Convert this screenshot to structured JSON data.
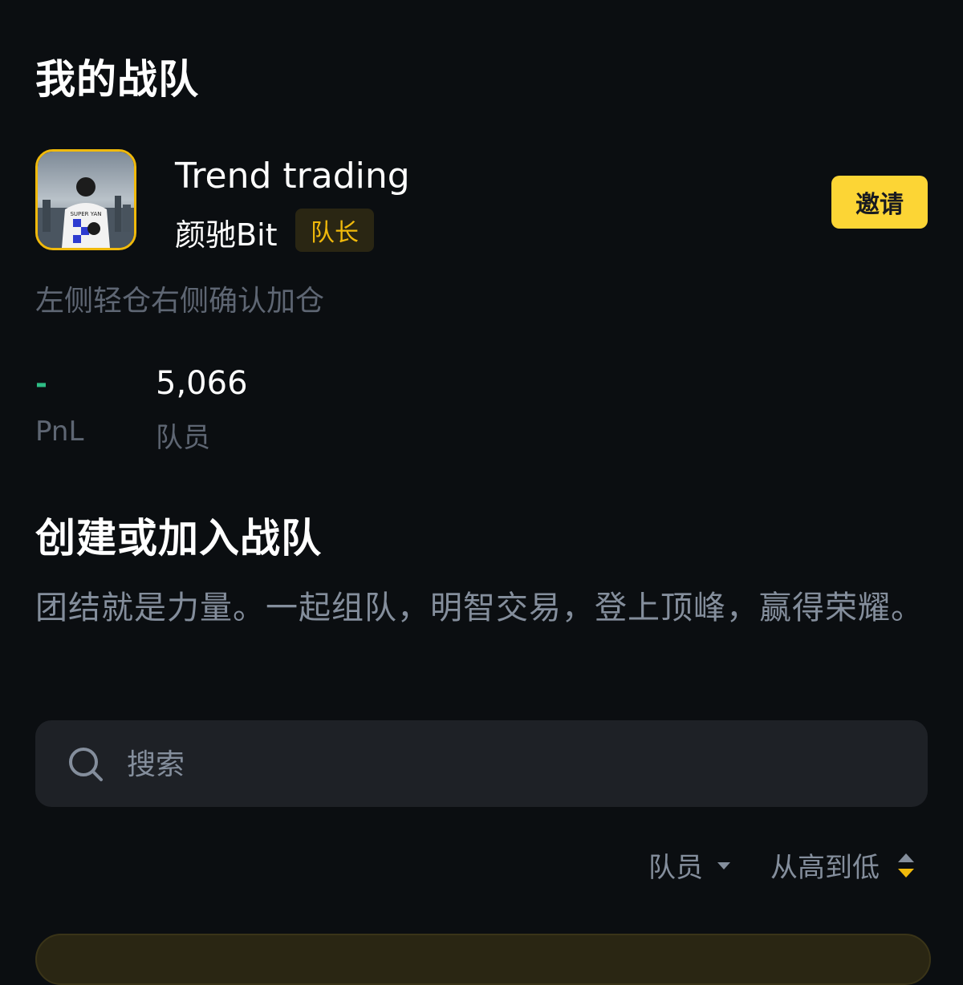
{
  "my_team": {
    "section_title": "我的战队",
    "team_name": "Trend trading",
    "captain_name": "颜驰Bit",
    "role_badge": "队长",
    "invite_label": "邀请",
    "description": "左侧轻仓右侧确认加仓",
    "avatar_shirt_text": "SUPER YAN",
    "stats": {
      "pnl_value": "-",
      "pnl_label": "PnL",
      "members_value": "5,066",
      "members_label": "队员"
    }
  },
  "create_join": {
    "section_title": "创建或加入战队",
    "slogan": "团结就是力量。一起组队，明智交易，登上顶峰，赢得荣耀。"
  },
  "search": {
    "placeholder": "搜索",
    "icon": "search-icon"
  },
  "sort": {
    "field_label": "队员",
    "order_label": "从高到低"
  },
  "colors": {
    "background": "#0b0e11",
    "accent": "#fcd535",
    "badge_text": "#f0b90b",
    "positive": "#2ebd85",
    "muted": "#5e6673",
    "secondary": "#848e9c"
  }
}
